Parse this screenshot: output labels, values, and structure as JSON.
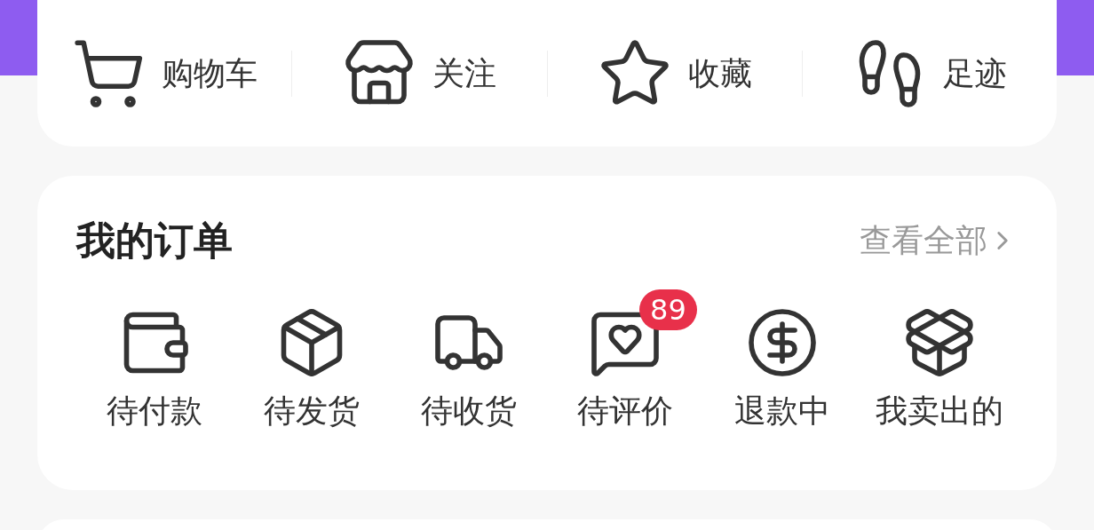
{
  "shortcuts": [
    {
      "label": "购物车"
    },
    {
      "label": "关注"
    },
    {
      "label": "收藏"
    },
    {
      "label": "足迹"
    }
  ],
  "orders": {
    "title": "我的订单",
    "view_all": "查看全部",
    "items": [
      {
        "label": "待付款"
      },
      {
        "label": "待发货"
      },
      {
        "label": "待收货"
      },
      {
        "label": "待评价",
        "badge": "89"
      },
      {
        "label": "退款中"
      },
      {
        "label": "我卖出的"
      }
    ]
  }
}
